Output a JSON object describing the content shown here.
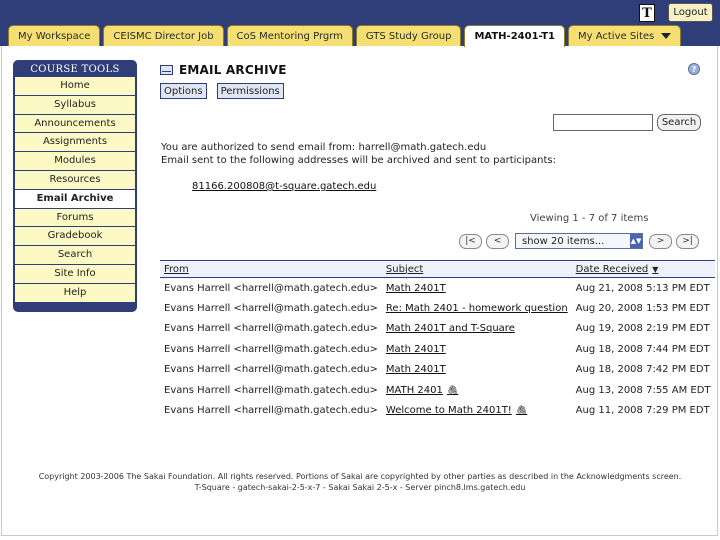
{
  "tabs": [
    "My Workspace",
    "CEISMC Director Job",
    "CoS Mentoring Prgrm",
    "GTS Study Group",
    "MATH-2401-T1",
    "My Active Sites"
  ],
  "header": {
    "logo_letter": "T",
    "logout_label": "Logout"
  },
  "sidebar": {
    "title": "COURSE TOOLS",
    "items": [
      "Home",
      "Syllabus",
      "Announcements",
      "Assignments",
      "Modules",
      "Resources",
      "Email Archive",
      "Forums",
      "Gradebook",
      "Search",
      "Site Info",
      "Help"
    ]
  },
  "main": {
    "title": "EMAIL ARCHIVE",
    "toolbar": {
      "options_label": "Options",
      "permissions_label": "Permissions"
    },
    "search": {
      "button_label": "Search",
      "value": ""
    },
    "info_line1": "You are authorized to send email from: harrell@math.gatech.edu",
    "info_line2": "Email sent to the following addresses will be archived and sent to participants:",
    "archive_address": "81166.200808@t-square.gatech.edu",
    "viewing": "Viewing 1 - 7 of 7 items",
    "pager": {
      "first": "|<",
      "prev": "<",
      "page_size": "show 20 items...",
      "next": ">",
      "last": ">|"
    },
    "table": {
      "headers": {
        "from": "From",
        "subject": "Subject",
        "date": "Date Received"
      },
      "rows": [
        {
          "from": "Evans Harrell <harrell@math.gatech.edu>",
          "subject": "Math 2401T",
          "date": "Aug 21, 2008 5:13 PM EDT",
          "attach": false
        },
        {
          "from": "Evans Harrell <harrell@math.gatech.edu>",
          "subject": "Re: Math 2401 - homework question",
          "date": "Aug 20, 2008 1:53 PM EDT",
          "attach": false
        },
        {
          "from": "Evans Harrell <harrell@math.gatech.edu>",
          "subject": "Math 2401T and T-Square",
          "date": "Aug 19, 2008 2:19 PM EDT",
          "attach": false
        },
        {
          "from": "Evans Harrell <harrell@math.gatech.edu>",
          "subject": "Math 2401T",
          "date": "Aug 18, 2008 7:44 PM EDT",
          "attach": false
        },
        {
          "from": "Evans Harrell <harrell@math.gatech.edu>",
          "subject": "Math 2401T",
          "date": "Aug 18, 2008 7:42 PM EDT",
          "attach": false
        },
        {
          "from": "Evans Harrell <harrell@math.gatech.edu>",
          "subject": "MATH 2401",
          "date": "Aug 13, 2008 7:55 AM EDT",
          "attach": true
        },
        {
          "from": "Evans Harrell <harrell@math.gatech.edu>",
          "subject": "Welcome to Math 2401T!",
          "date": "Aug 11, 2008 7:29 PM EDT",
          "attach": true
        }
      ]
    }
  },
  "footer": {
    "line1": "Copyright 2003-2006 The Sakai Foundation. All rights reserved. Portions of Sakai are copyrighted by other parties as described in the Acknowledgments screen.",
    "line2": "T-Square - gatech-sakai-2-5-x-7 - Sakai Sakai 2-5-x - Server pinch8.lms.gatech.edu"
  },
  "colors": {
    "header_bg": "#2f3e78",
    "tab_bg": "#f5df72",
    "nav_bg": "#fcf9c4"
  }
}
